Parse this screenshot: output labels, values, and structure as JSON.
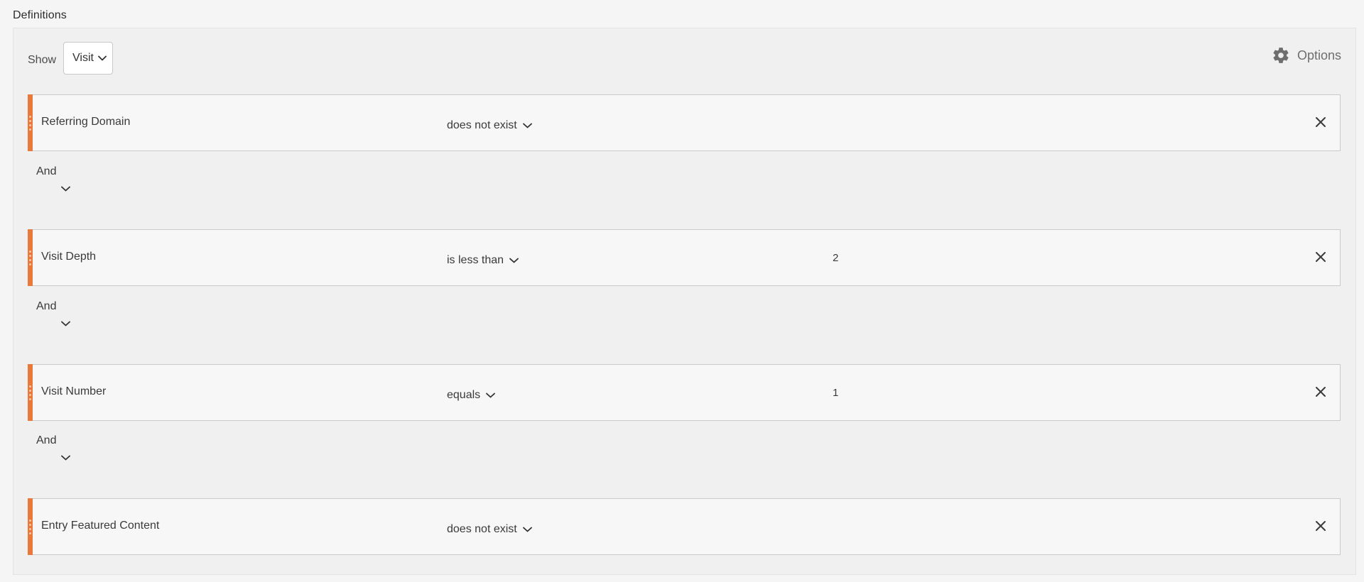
{
  "section": {
    "title": "Definitions"
  },
  "toolbar": {
    "show_label": "Show",
    "show_value": "Visit",
    "options_label": "Options"
  },
  "icons": {
    "gear": "gear-icon",
    "chevron": "chevron-down-icon",
    "close": "close-icon",
    "drag": "drag-handle-icon"
  },
  "colors": {
    "accent": "#e8793a",
    "panel_bg": "#f0f0f0",
    "rule_bg": "#f7f7f7",
    "border": "#cacaca"
  },
  "rules": [
    {
      "dimension": "Referring Domain",
      "operator": "does not exist",
      "value": ""
    },
    {
      "dimension": "Visit Depth",
      "operator": "is less than",
      "value": "2"
    },
    {
      "dimension": "Visit Number",
      "operator": "equals",
      "value": "1"
    },
    {
      "dimension": "Entry Featured Content",
      "operator": "does not exist",
      "value": ""
    }
  ],
  "connectors": [
    {
      "label": "And"
    },
    {
      "label": "And"
    },
    {
      "label": "And"
    }
  ]
}
